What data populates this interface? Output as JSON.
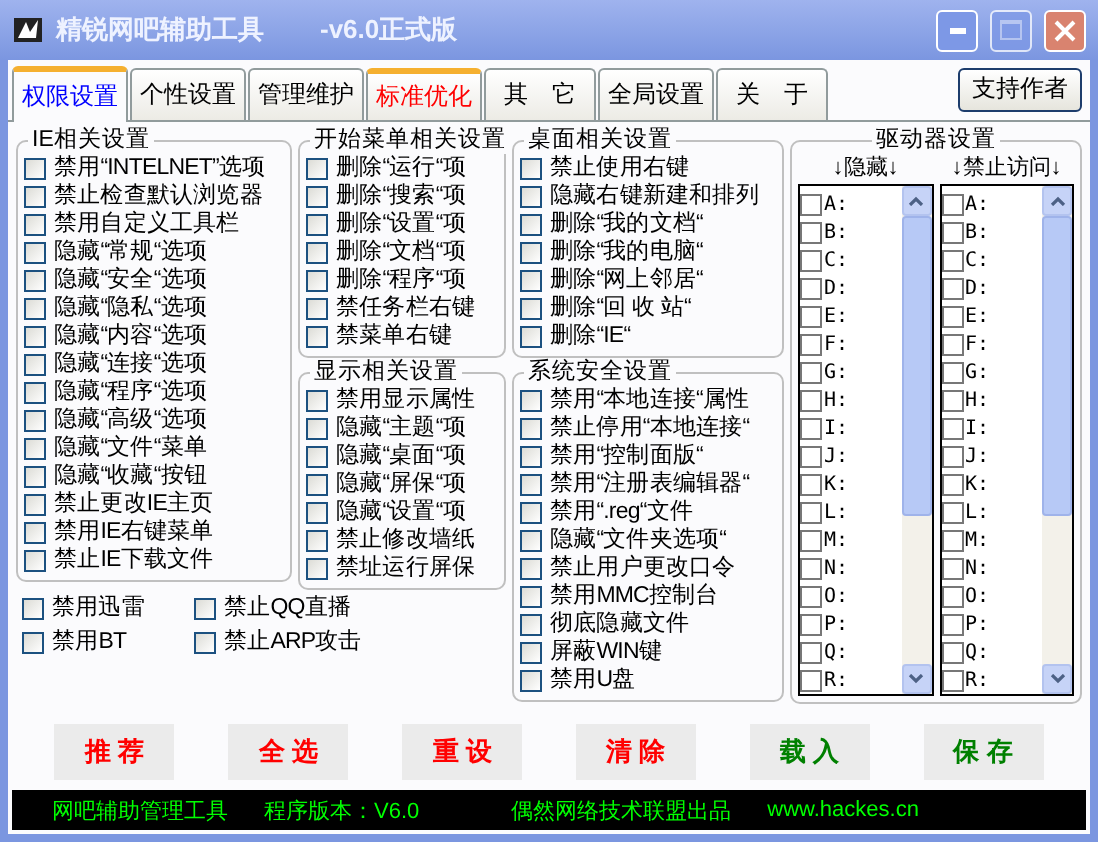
{
  "window": {
    "title": "精锐网吧辅助工具",
    "version": "-v6.0正式版"
  },
  "tabs": [
    {
      "label": "权限设置",
      "selected": true,
      "hot": false
    },
    {
      "label": "个性设置",
      "selected": false,
      "hot": false
    },
    {
      "label": "管理维护",
      "selected": false,
      "hot": false
    },
    {
      "label": "标准优化",
      "selected": false,
      "hot": true
    },
    {
      "label": "其　它",
      "selected": false,
      "hot": false
    },
    {
      "label": "全局设置",
      "selected": false,
      "hot": false
    },
    {
      "label": "关　于",
      "selected": false,
      "hot": false
    }
  ],
  "support_button": "支持作者",
  "groups": [
    {
      "title": "IE相关设置",
      "items": [
        {
          "label": "禁用“INTELNET”选项",
          "checked": false
        },
        {
          "label": "禁止检查默认浏览器",
          "checked": false
        },
        {
          "label": "禁用自定义工具栏",
          "checked": false
        },
        {
          "label": "隐藏“常规“选项",
          "checked": false
        },
        {
          "label": "隐藏“安全“选项",
          "checked": false
        },
        {
          "label": "隐藏“隐私“选项",
          "checked": false
        },
        {
          "label": "隐藏“内容“选项",
          "checked": false
        },
        {
          "label": "隐藏“连接“选项",
          "checked": false
        },
        {
          "label": "隐藏“程序“选项",
          "checked": false
        },
        {
          "label": "隐藏“高级“选项",
          "checked": false
        },
        {
          "label": "隐藏“文件“菜单",
          "checked": false
        },
        {
          "label": "隐藏“收藏“按钮",
          "checked": false
        },
        {
          "label": "禁止更改IE主页",
          "checked": false
        },
        {
          "label": "禁用IE右键菜单",
          "checked": false
        },
        {
          "label": "禁止IE下载文件",
          "checked": false
        }
      ]
    },
    {
      "title": "开始菜单相关设置",
      "items": [
        {
          "label": "删除“运行“项",
          "checked": false
        },
        {
          "label": "删除“搜索“项",
          "checked": false
        },
        {
          "label": "删除“设置“项",
          "checked": false
        },
        {
          "label": "删除“文档“项",
          "checked": false
        },
        {
          "label": "删除“程序“项",
          "checked": false
        },
        {
          "label": "禁任务栏右键",
          "checked": false
        },
        {
          "label": "禁菜单右键",
          "checked": false
        }
      ]
    },
    {
      "title": "显示相关设置",
      "items": [
        {
          "label": "禁用显示属性",
          "checked": false
        },
        {
          "label": "隐藏“主题“项",
          "checked": false
        },
        {
          "label": "隐藏“桌面“项",
          "checked": false
        },
        {
          "label": "隐藏“屏保“项",
          "checked": false
        },
        {
          "label": "隐藏“设置“项",
          "checked": false
        },
        {
          "label": "禁止修改墙纸",
          "checked": false
        },
        {
          "label": "禁址运行屏保",
          "checked": false
        }
      ]
    },
    {
      "title": "桌面相关设置",
      "items": [
        {
          "label": "禁止使用右键",
          "checked": false
        },
        {
          "label": "隐藏右键新建和排列",
          "checked": false
        },
        {
          "label": "删除“我的文档“",
          "checked": false
        },
        {
          "label": "删除“我的电脑“",
          "checked": false
        },
        {
          "label": "删除“网上邻居“",
          "checked": false
        },
        {
          "label": "删除“回 收 站“",
          "checked": false
        },
        {
          "label": "删除“IE“",
          "checked": false
        }
      ]
    },
    {
      "title": "系统安全设置",
      "items": [
        {
          "label": "禁用“本地连接“属性",
          "checked": false
        },
        {
          "label": "禁止停用“本地连接“",
          "checked": false
        },
        {
          "label": "禁用“控制面版“",
          "checked": false
        },
        {
          "label": "禁用“注册表编辑器“",
          "checked": false
        },
        {
          "label": "禁用“.reg“文件",
          "checked": false
        },
        {
          "label": "隐藏“文件夹选项“",
          "checked": false
        },
        {
          "label": "禁止用户更改口令",
          "checked": false
        },
        {
          "label": "禁用MMC控制台",
          "checked": false
        },
        {
          "label": "彻底隐藏文件",
          "checked": false
        },
        {
          "label": "屏蔽WIN键",
          "checked": false
        },
        {
          "label": "禁用U盘",
          "checked": false
        }
      ]
    }
  ],
  "extra_options": [
    {
      "label": "禁用迅雷",
      "checked": false
    },
    {
      "label": "禁止QQ直播",
      "checked": false
    },
    {
      "label": "禁用BT",
      "checked": false
    },
    {
      "label": "禁止ARP攻击",
      "checked": false
    }
  ],
  "drives": {
    "title": "驱动器设置",
    "lists": [
      {
        "header": "↓隐藏↓",
        "items": [
          {
            "label": "A:",
            "checked": false
          },
          {
            "label": "B:",
            "checked": false
          },
          {
            "label": "C:",
            "checked": false
          },
          {
            "label": "D:",
            "checked": false
          },
          {
            "label": "E:",
            "checked": false
          },
          {
            "label": "F:",
            "checked": false
          },
          {
            "label": "G:",
            "checked": false
          },
          {
            "label": "H:",
            "checked": false
          },
          {
            "label": "I:",
            "checked": false
          },
          {
            "label": "J:",
            "checked": false
          },
          {
            "label": "K:",
            "checked": false
          },
          {
            "label": "L:",
            "checked": false
          },
          {
            "label": "M:",
            "checked": false
          },
          {
            "label": "N:",
            "checked": false
          },
          {
            "label": "O:",
            "checked": false
          },
          {
            "label": "P:",
            "checked": false
          },
          {
            "label": "Q:",
            "checked": false
          },
          {
            "label": "R:",
            "checked": false
          }
        ]
      },
      {
        "header": "↓禁止访问↓",
        "items": [
          {
            "label": "A:",
            "checked": false
          },
          {
            "label": "B:",
            "checked": false
          },
          {
            "label": "C:",
            "checked": false
          },
          {
            "label": "D:",
            "checked": false
          },
          {
            "label": "E:",
            "checked": false
          },
          {
            "label": "F:",
            "checked": false
          },
          {
            "label": "G:",
            "checked": false
          },
          {
            "label": "H:",
            "checked": false
          },
          {
            "label": "I:",
            "checked": false
          },
          {
            "label": "J:",
            "checked": false
          },
          {
            "label": "K:",
            "checked": false
          },
          {
            "label": "L:",
            "checked": false
          },
          {
            "label": "M:",
            "checked": false
          },
          {
            "label": "N:",
            "checked": false
          },
          {
            "label": "O:",
            "checked": false
          },
          {
            "label": "P:",
            "checked": false
          },
          {
            "label": "Q:",
            "checked": false
          },
          {
            "label": "R:",
            "checked": false
          }
        ]
      }
    ]
  },
  "buttons": [
    {
      "label": "推 荐",
      "color": "#ff0000"
    },
    {
      "label": "全 选",
      "color": "#ff0000"
    },
    {
      "label": "重 设",
      "color": "#ff0000"
    },
    {
      "label": "清 除",
      "color": "#ff0000"
    },
    {
      "label": "载 入",
      "color": "#008000"
    },
    {
      "label": "保 存",
      "color": "#008000"
    }
  ],
  "status_bar": [
    "网吧辅助管理工具",
    "程序版本：V6.0",
    "偶然网络技术联盟出品",
    "www.hackes.cn"
  ]
}
